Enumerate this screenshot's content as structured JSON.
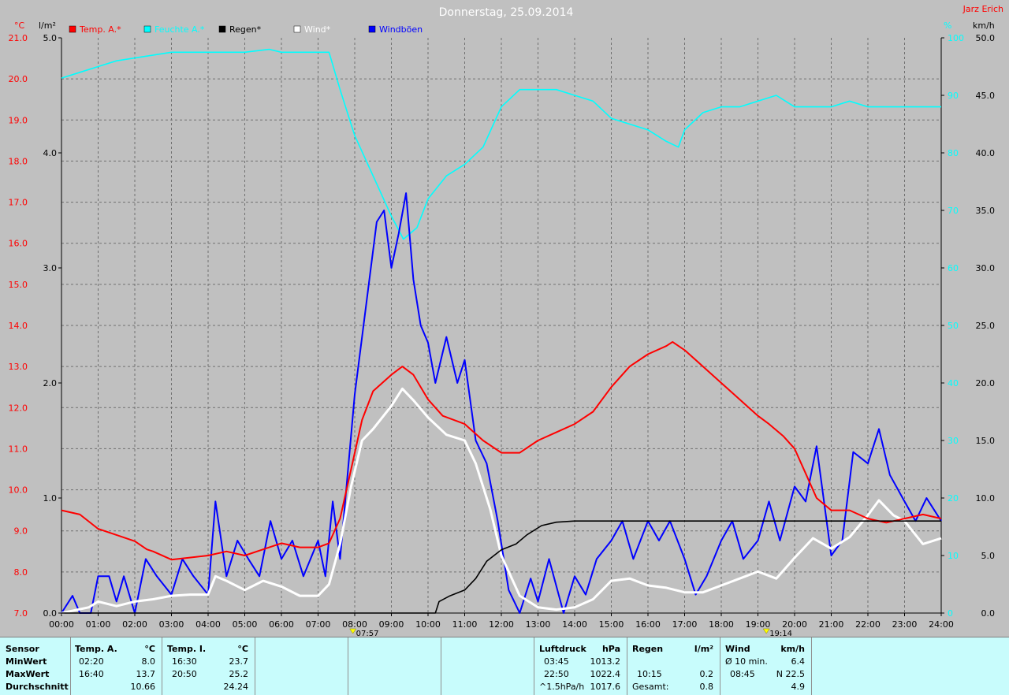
{
  "chart_data": {
    "type": "line",
    "title": "Donnerstag, 25.09.2014",
    "corner_label": "Jarz Erich",
    "legend": [
      {
        "name": "Temp. A.*",
        "color": "#ff0000"
      },
      {
        "name": "Feuchte A.*",
        "color": "#00ffff"
      },
      {
        "name": "Regen*",
        "color": "#000000"
      },
      {
        "name": "Wind*",
        "color": "#ffffff"
      },
      {
        "name": "Windböen",
        "color": "#0000ff"
      }
    ],
    "axes": {
      "temp": {
        "unit": "°C",
        "min": 7.0,
        "max": 21.0,
        "ticks": [
          "7.0",
          "8.0",
          "9.0",
          "10.0",
          "11.0",
          "12.0",
          "13.0",
          "14.0",
          "15.0",
          "16.0",
          "17.0",
          "18.0",
          "19.0",
          "20.0",
          "21.0"
        ],
        "color": "#ff0000"
      },
      "rain": {
        "unit": "l/m²",
        "min": 0,
        "max": 5,
        "ticks": [
          "0.0",
          "1.0",
          "2.0",
          "3.0",
          "4.0",
          "5.0"
        ]
      },
      "humidity": {
        "unit": "%",
        "min": 0,
        "max": 100,
        "ticks": [
          "0",
          "10",
          "20",
          "30",
          "40",
          "50",
          "60",
          "70",
          "80",
          "90",
          "100"
        ],
        "color": "#00ffff"
      },
      "wind": {
        "unit": "km/h",
        "min": 0,
        "max": 50,
        "ticks": [
          "0.0",
          "5.0",
          "10.0",
          "15.0",
          "20.0",
          "25.0",
          "30.0",
          "35.0",
          "40.0",
          "45.0",
          "50.0"
        ]
      },
      "x": {
        "min": 0,
        "max": 24,
        "ticks": [
          "00:00",
          "01:00",
          "02:00",
          "03:00",
          "04:00",
          "05:00",
          "06:00",
          "07:00",
          "08:00",
          "09:00",
          "10:00",
          "11:00",
          "12:00",
          "13:00",
          "14:00",
          "15:00",
          "16:00",
          "17:00",
          "18:00",
          "19:00",
          "20:00",
          "21:00",
          "22:00",
          "23:00",
          "24:00"
        ]
      }
    },
    "markers": [
      {
        "hour": 7.95,
        "label": "07:57"
      },
      {
        "hour": 19.23,
        "label": "19:14"
      }
    ],
    "series": [
      {
        "name": "Temp. A.*",
        "axis": "temp",
        "color": "#ff0000",
        "points": [
          [
            0,
            9.5
          ],
          [
            0.5,
            9.4
          ],
          [
            1,
            9.05
          ],
          [
            1.5,
            8.9
          ],
          [
            2,
            8.75
          ],
          [
            2.33,
            8.55
          ],
          [
            2.5,
            8.5
          ],
          [
            3,
            8.3
          ],
          [
            3.5,
            8.35
          ],
          [
            4,
            8.4
          ],
          [
            4.5,
            8.5
          ],
          [
            5,
            8.4
          ],
          [
            5.5,
            8.55
          ],
          [
            6,
            8.7
          ],
          [
            6.5,
            8.6
          ],
          [
            7,
            8.6
          ],
          [
            7.3,
            8.7
          ],
          [
            7.6,
            9.3
          ],
          [
            7.9,
            10.5
          ],
          [
            8.2,
            11.7
          ],
          [
            8.5,
            12.4
          ],
          [
            9,
            12.8
          ],
          [
            9.3,
            13.0
          ],
          [
            9.6,
            12.8
          ],
          [
            10,
            12.2
          ],
          [
            10.4,
            11.8
          ],
          [
            11,
            11.6
          ],
          [
            11.5,
            11.2
          ],
          [
            12,
            10.9
          ],
          [
            12.5,
            10.9
          ],
          [
            13,
            11.2
          ],
          [
            13.5,
            11.4
          ],
          [
            14,
            11.6
          ],
          [
            14.5,
            11.9
          ],
          [
            15,
            12.5
          ],
          [
            15.5,
            13.0
          ],
          [
            16,
            13.3
          ],
          [
            16.5,
            13.5
          ],
          [
            16.67,
            13.6
          ],
          [
            17,
            13.4
          ],
          [
            17.5,
            13.0
          ],
          [
            18,
            12.6
          ],
          [
            18.5,
            12.2
          ],
          [
            19,
            11.8
          ],
          [
            19.3,
            11.6
          ],
          [
            19.7,
            11.3
          ],
          [
            20,
            11.0
          ],
          [
            20.3,
            10.4
          ],
          [
            20.6,
            9.8
          ],
          [
            21,
            9.5
          ],
          [
            21.5,
            9.5
          ],
          [
            22,
            9.3
          ],
          [
            22.5,
            9.2
          ],
          [
            23,
            9.3
          ],
          [
            23.5,
            9.4
          ],
          [
            24,
            9.3
          ]
        ]
      },
      {
        "name": "Feuchte A.*",
        "axis": "humidity",
        "color": "#00ffff",
        "points": [
          [
            0,
            93
          ],
          [
            0.5,
            94
          ],
          [
            1,
            95
          ],
          [
            1.5,
            96
          ],
          [
            2,
            96.5
          ],
          [
            2.5,
            97
          ],
          [
            3,
            97.5
          ],
          [
            4,
            97.5
          ],
          [
            5,
            97.5
          ],
          [
            5.67,
            98
          ],
          [
            6,
            97.5
          ],
          [
            6.5,
            97.5
          ],
          [
            7,
            97.5
          ],
          [
            7.3,
            97.5
          ],
          [
            7.6,
            91
          ],
          [
            8,
            83
          ],
          [
            8.5,
            76
          ],
          [
            9,
            69
          ],
          [
            9.33,
            65
          ],
          [
            9.7,
            67
          ],
          [
            10,
            72
          ],
          [
            10.5,
            76
          ],
          [
            11,
            78
          ],
          [
            11.5,
            81
          ],
          [
            12,
            88
          ],
          [
            12.5,
            91
          ],
          [
            13,
            91
          ],
          [
            13.5,
            91
          ],
          [
            14,
            90
          ],
          [
            14.5,
            89
          ],
          [
            15,
            86
          ],
          [
            15.5,
            85
          ],
          [
            16,
            84
          ],
          [
            16.5,
            82
          ],
          [
            16.83,
            81
          ],
          [
            17,
            84
          ],
          [
            17.5,
            87
          ],
          [
            18,
            88
          ],
          [
            18.5,
            88
          ],
          [
            19,
            89
          ],
          [
            19.5,
            90
          ],
          [
            20,
            88
          ],
          [
            20.5,
            88
          ],
          [
            21,
            88
          ],
          [
            21.5,
            89
          ],
          [
            22,
            88
          ],
          [
            22.5,
            88
          ],
          [
            23,
            88
          ],
          [
            23.5,
            88
          ],
          [
            24,
            88
          ]
        ]
      },
      {
        "name": "Regen*",
        "axis": "rain",
        "color": "#000000",
        "points": [
          [
            0,
            0
          ],
          [
            10.2,
            0
          ],
          [
            10.3,
            0.1
          ],
          [
            10.6,
            0.15
          ],
          [
            11,
            0.2
          ],
          [
            11.3,
            0.3
          ],
          [
            11.6,
            0.45
          ],
          [
            12,
            0.55
          ],
          [
            12.4,
            0.6
          ],
          [
            12.7,
            0.68
          ],
          [
            13.1,
            0.76
          ],
          [
            13.5,
            0.79
          ],
          [
            14,
            0.8
          ],
          [
            24,
            0.8
          ]
        ]
      },
      {
        "name": "Wind*",
        "axis": "wind",
        "color": "#ffffff",
        "points": [
          [
            0,
            0
          ],
          [
            0.75,
            0.5
          ],
          [
            1,
            1
          ],
          [
            1.5,
            0.6
          ],
          [
            2,
            1
          ],
          [
            2.5,
            1.2
          ],
          [
            3,
            1.5
          ],
          [
            3.5,
            1.6
          ],
          [
            4,
            1.6
          ],
          [
            4.2,
            3.2
          ],
          [
            4.5,
            2.8
          ],
          [
            5,
            2
          ],
          [
            5.5,
            2.8
          ],
          [
            6,
            2.3
          ],
          [
            6.5,
            1.5
          ],
          [
            7,
            1.5
          ],
          [
            7.3,
            2.5
          ],
          [
            7.6,
            6
          ],
          [
            7.9,
            11
          ],
          [
            8.2,
            15
          ],
          [
            8.5,
            16
          ],
          [
            9,
            18
          ],
          [
            9.3,
            19.5
          ],
          [
            9.6,
            18.5
          ],
          [
            10,
            17
          ],
          [
            10.5,
            15.5
          ],
          [
            11,
            15
          ],
          [
            11.3,
            13
          ],
          [
            11.7,
            9
          ],
          [
            12,
            5
          ],
          [
            12.5,
            1.5
          ],
          [
            13,
            0.5
          ],
          [
            13.5,
            0.3
          ],
          [
            14,
            0.5
          ],
          [
            14.5,
            1.2
          ],
          [
            15,
            2.8
          ],
          [
            15.5,
            3
          ],
          [
            16,
            2.4
          ],
          [
            16.5,
            2.2
          ],
          [
            17,
            1.8
          ],
          [
            17.5,
            1.8
          ],
          [
            18,
            2.4
          ],
          [
            18.5,
            3
          ],
          [
            19,
            3.6
          ],
          [
            19.5,
            3.0
          ],
          [
            20,
            4.8
          ],
          [
            20.5,
            6.5
          ],
          [
            21,
            5.6
          ],
          [
            21.5,
            6.6
          ],
          [
            22,
            8.5
          ],
          [
            22.3,
            9.8
          ],
          [
            22.7,
            8.5
          ],
          [
            23,
            8
          ],
          [
            23.5,
            6
          ],
          [
            24,
            6.5
          ]
        ]
      },
      {
        "name": "Windböen",
        "axis": "wind",
        "color": "#0000ff",
        "points": [
          [
            0,
            0
          ],
          [
            0.3,
            1.5
          ],
          [
            0.5,
            0
          ],
          [
            0.8,
            0
          ],
          [
            1,
            3.2
          ],
          [
            1.3,
            3.2
          ],
          [
            1.5,
            1
          ],
          [
            1.7,
            3.2
          ],
          [
            2,
            0
          ],
          [
            2.3,
            4.7
          ],
          [
            2.6,
            3.2
          ],
          [
            3,
            1.6
          ],
          [
            3.3,
            4.7
          ],
          [
            3.6,
            3.2
          ],
          [
            4,
            1.6
          ],
          [
            4.2,
            9.7
          ],
          [
            4.5,
            3.2
          ],
          [
            4.8,
            6.3
          ],
          [
            5.1,
            4.7
          ],
          [
            5.4,
            3.2
          ],
          [
            5.7,
            8
          ],
          [
            6,
            4.7
          ],
          [
            6.3,
            6.3
          ],
          [
            6.6,
            3.2
          ],
          [
            7,
            6.3
          ],
          [
            7.2,
            3.2
          ],
          [
            7.4,
            9.7
          ],
          [
            7.6,
            4.7
          ],
          [
            8,
            19
          ],
          [
            8.2,
            24
          ],
          [
            8.4,
            29
          ],
          [
            8.6,
            34
          ],
          [
            8.8,
            35
          ],
          [
            9,
            30
          ],
          [
            9.2,
            33
          ],
          [
            9.4,
            36.5
          ],
          [
            9.6,
            29
          ],
          [
            9.8,
            25
          ],
          [
            10,
            23.5
          ],
          [
            10.2,
            20
          ],
          [
            10.5,
            24
          ],
          [
            10.8,
            20
          ],
          [
            11,
            22
          ],
          [
            11.3,
            15
          ],
          [
            11.6,
            13
          ],
          [
            11.9,
            8
          ],
          [
            12.2,
            2
          ],
          [
            12.5,
            0
          ],
          [
            12.8,
            3
          ],
          [
            13,
            1
          ],
          [
            13.3,
            4.7
          ],
          [
            13.7,
            0
          ],
          [
            14,
            3.2
          ],
          [
            14.3,
            1.6
          ],
          [
            14.6,
            4.7
          ],
          [
            15,
            6.3
          ],
          [
            15.3,
            8
          ],
          [
            15.6,
            4.7
          ],
          [
            16,
            8
          ],
          [
            16.3,
            6.3
          ],
          [
            16.6,
            8
          ],
          [
            17,
            4.7
          ],
          [
            17.3,
            1.6
          ],
          [
            17.6,
            3.2
          ],
          [
            18,
            6.3
          ],
          [
            18.3,
            8
          ],
          [
            18.6,
            4.7
          ],
          [
            19,
            6.3
          ],
          [
            19.3,
            9.7
          ],
          [
            19.6,
            6.3
          ],
          [
            20,
            11
          ],
          [
            20.3,
            9.7
          ],
          [
            20.6,
            14.5
          ],
          [
            21,
            5
          ],
          [
            21.3,
            6.3
          ],
          [
            21.6,
            14
          ],
          [
            22,
            13
          ],
          [
            22.3,
            16
          ],
          [
            22.6,
            12
          ],
          [
            23,
            9.7
          ],
          [
            23.3,
            8
          ],
          [
            23.6,
            10
          ],
          [
            24,
            8
          ]
        ]
      }
    ]
  },
  "panel": {
    "sensor_header": "Sensor",
    "rows": [
      "MinWert",
      "MaxWert",
      "Durchschnitt"
    ],
    "temp_a": {
      "header": "Temp. A.",
      "unit": "°C",
      "min_time": "02:20",
      "min_val": "8.0",
      "max_time": "16:40",
      "max_val": "13.7",
      "avg": "10.66"
    },
    "temp_i": {
      "header": "Temp. I.",
      "unit": "°C",
      "min_time": "16:30",
      "min_val": "23.7",
      "max_time": "20:50",
      "max_val": "25.2",
      "avg": "24.24"
    },
    "pressure": {
      "header": "Luftdruck",
      "unit": "hPa",
      "min_time": "03:45",
      "min_val": "1013.2",
      "max_time": "22:50",
      "max_val": "1022.4",
      "trend_label": "^1.5hPa/h",
      "avg": "1017.6"
    },
    "rain": {
      "header": "Regen",
      "unit": "l/m²",
      "max_time": "10:15",
      "max_val": "0.2",
      "total_label": "Gesamt:",
      "total": "0.8"
    },
    "wind": {
      "header": "Wind",
      "unit": "km/h",
      "avg10_label": "Ø 10 min.",
      "avg10": "6.4",
      "max_time": "08:45",
      "max_val": "N 22.5",
      "avg": "4.9"
    }
  }
}
